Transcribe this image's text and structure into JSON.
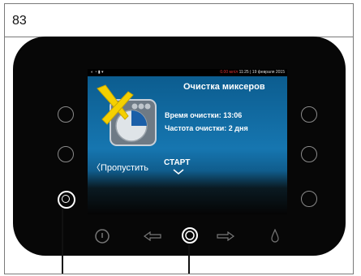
{
  "figure_number": "83",
  "screen": {
    "status": {
      "red_text": "0.00 мл/л",
      "time": "11:25",
      "date": "19 февраля 2015"
    },
    "title": "Очистка миксеров",
    "cleaning_time": "Время очистки: 13:06",
    "cleaning_frequency": "Частота очистки: 2 дня",
    "skip_label": "Пропустить",
    "start_label": "СТАРТ"
  },
  "bottom_buttons": [
    "power-icon",
    "arrow-left-icon",
    "arrow-down-icon",
    "arrow-right-icon",
    "drop-icon"
  ],
  "colors": {
    "screen_blue": "#1676b0",
    "icon_yellow": "#f5d000",
    "status_red": "#e03030"
  }
}
